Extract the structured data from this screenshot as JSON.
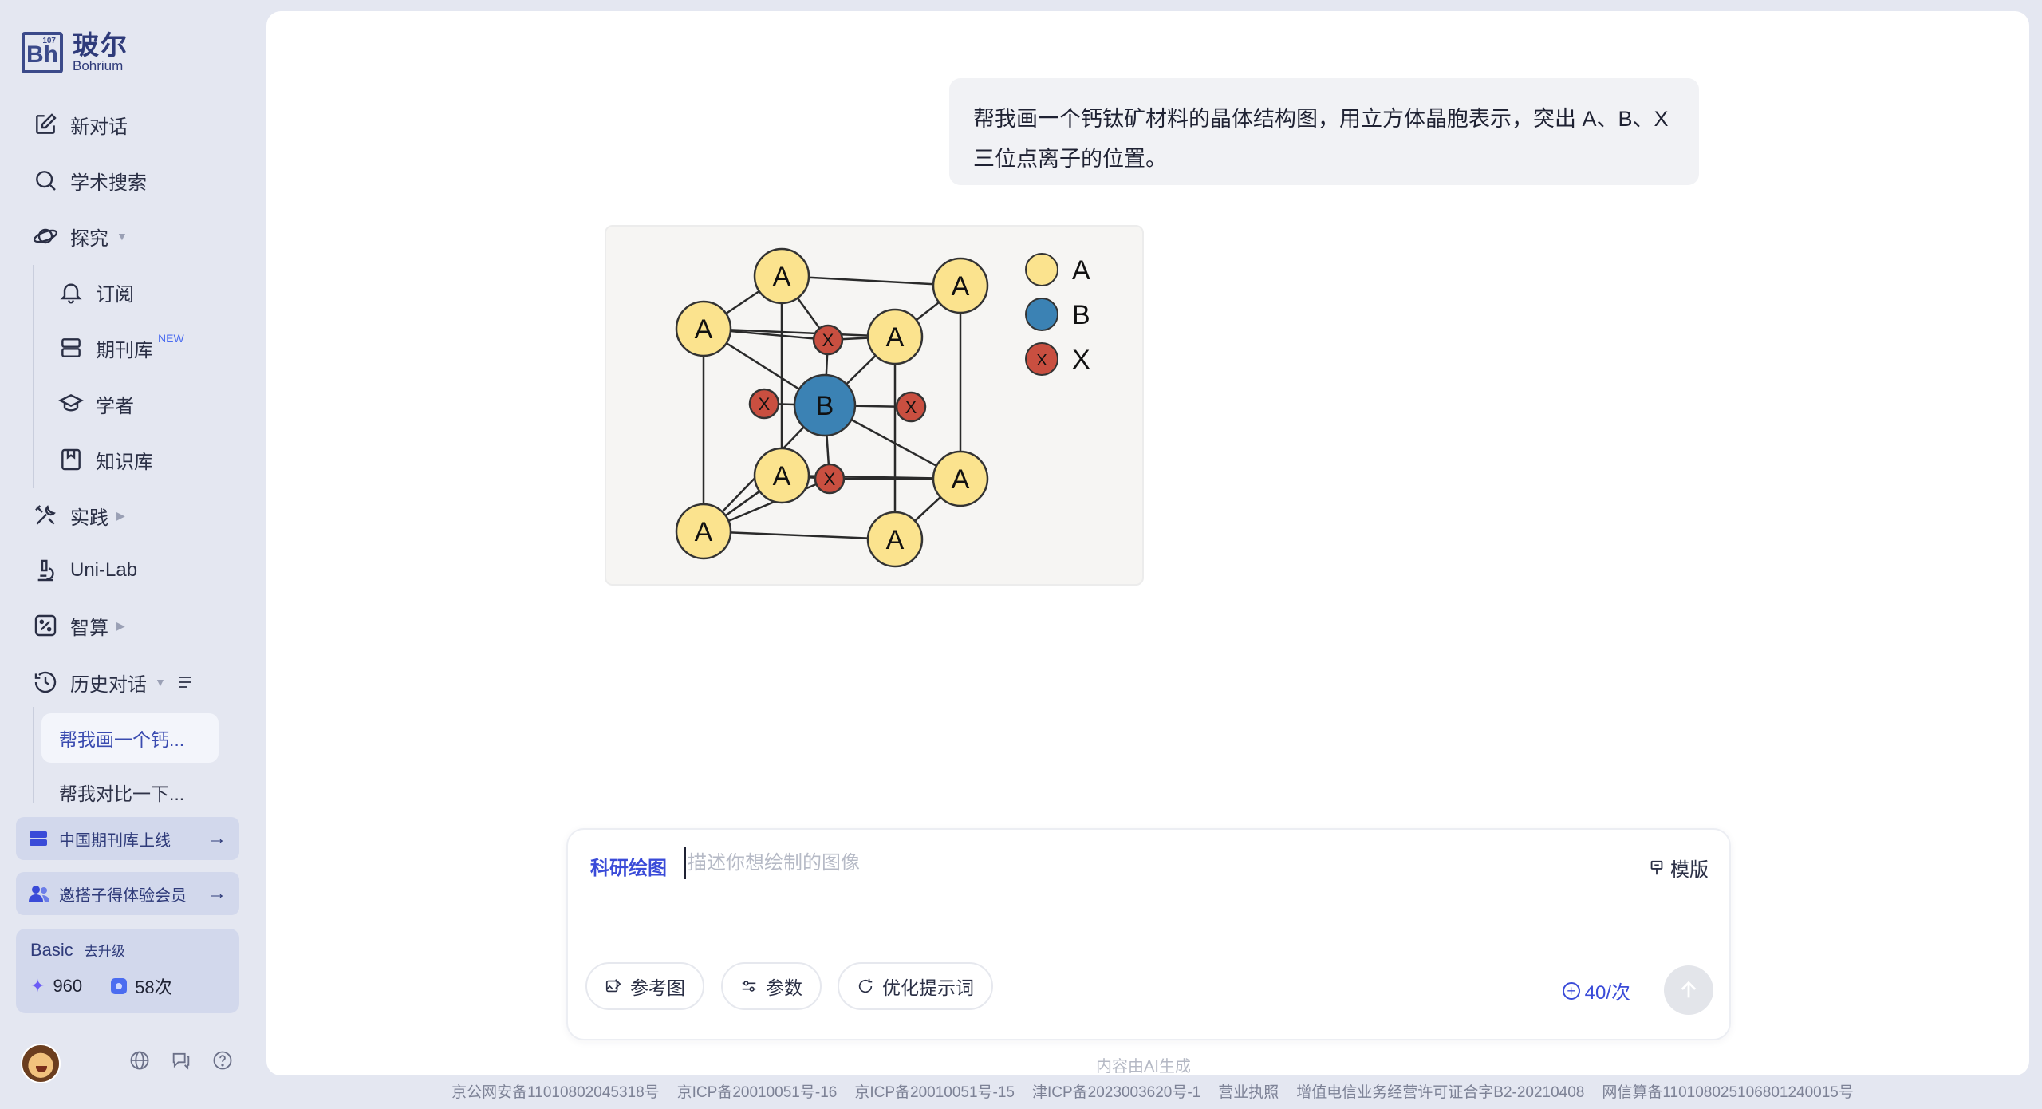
{
  "brand": {
    "cn": "玻尔",
    "en": "Bohrium",
    "mark": "Bh",
    "mark_num": "107"
  },
  "nav": {
    "new_chat": "新对话",
    "search": "学术搜索",
    "explore": "探究",
    "subscribe": "订阅",
    "journals": "期刊库",
    "journals_badge": "NEW",
    "scholars": "学者",
    "knowledge": "知识库",
    "practice": "实践",
    "unilab": "Uni-Lab",
    "compute": "智算",
    "history": "历史对话"
  },
  "history_items": [
    {
      "label": "帮我画一个钙...",
      "active": true
    },
    {
      "label": "帮我对比一下..."
    }
  ],
  "promos": [
    {
      "label": "中国期刊库上线"
    },
    {
      "label": "邀搭子得体验会员"
    }
  ],
  "plan": {
    "name": "Basic",
    "upgrade": "去升级",
    "points": "960",
    "uses": "58次"
  },
  "chat": {
    "user_message": "帮我画一个钙钛矿材料的晶体结构图，用立方体晶胞表示，突出 A、B、X 三位点离子的位置。"
  },
  "figure": {
    "legend": [
      {
        "label": "A",
        "color": "#fbe38e"
      },
      {
        "label": "B",
        "color": "#3b82b4"
      },
      {
        "label": "X",
        "color": "#c94f40"
      }
    ],
    "atom_labels": {
      "a": "A",
      "b": "B",
      "x": "X"
    },
    "colors": {
      "a": "#fbe38e",
      "b": "#3b82b4",
      "x": "#c94f40"
    }
  },
  "composer": {
    "mode": "科研绘图",
    "placeholder": "描述你想绘制的图像",
    "template": "模版",
    "ref_image": "参考图",
    "params": "参数",
    "optimize": "优化提示词",
    "cost": "40/次",
    "ai_note": "内容由AI生成"
  },
  "footer": [
    "京公网安备11010802045318号",
    "京ICP备20010051号-16",
    "京ICP备20010051号-15",
    "津ICP备2023003620号-1",
    "营业执照",
    "增值电信业务经营许可证合字B2-20210408",
    "网信算备110108025106801240015号"
  ]
}
